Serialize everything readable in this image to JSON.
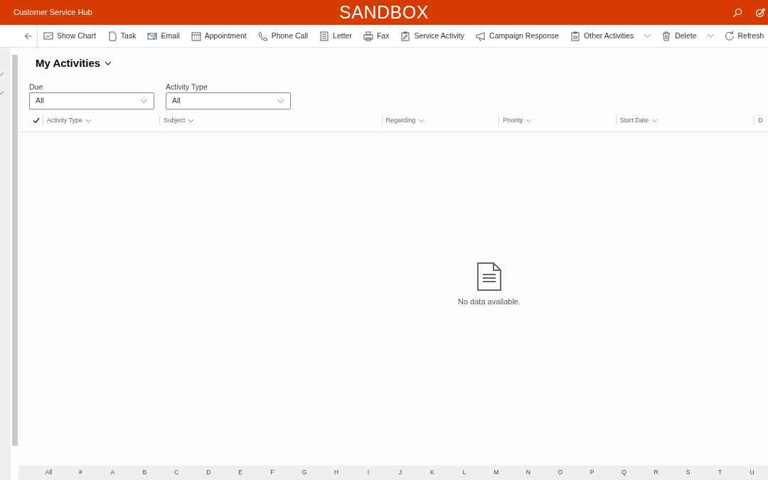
{
  "app": {
    "title": "Customer Service Hub",
    "environment": "SANDBOX"
  },
  "toolbar": [
    {
      "kind": "chart",
      "label": "Show Chart"
    },
    {
      "kind": "task",
      "label": "Task"
    },
    {
      "kind": "email",
      "label": "Email"
    },
    {
      "kind": "calendar",
      "label": "Appointment"
    },
    {
      "kind": "phone",
      "label": "Phone Call"
    },
    {
      "kind": "letter",
      "label": "Letter"
    },
    {
      "kind": "fax",
      "label": "Fax"
    },
    {
      "kind": "service",
      "label": "Service Activity"
    },
    {
      "kind": "megaphone",
      "label": "Campaign Response"
    },
    {
      "kind": "clipboard",
      "label": "Other Activities",
      "dropdown": true
    },
    {
      "kind": "trash",
      "label": "Delete",
      "split_menu": true
    },
    {
      "kind": "refresh",
      "label": "Refresh"
    }
  ],
  "view": {
    "title": "My Activities"
  },
  "filters": [
    {
      "label": "Due",
      "value": "All"
    },
    {
      "label": "Activity Type",
      "value": "All"
    }
  ],
  "table": {
    "columns": [
      "Activity Type",
      "Subject",
      "Regarding",
      "Priority",
      "Start Date",
      "D"
    ],
    "empty_message": "No data available."
  },
  "alphabet": [
    "All",
    "#",
    "A",
    "B",
    "C",
    "D",
    "E",
    "F",
    "G",
    "H",
    "I",
    "J",
    "K",
    "L",
    "M",
    "N",
    "O",
    "P",
    "Q",
    "R",
    "S",
    "T",
    "U"
  ]
}
